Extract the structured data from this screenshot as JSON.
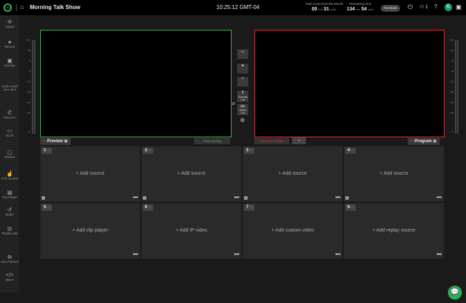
{
  "header": {
    "logo": "TVU",
    "title": "Morning Talk Show",
    "clock": "10:25:12 GMT-04",
    "consumed": {
      "label": "Total Consumed this Month",
      "hrs": "00",
      "mins": "31",
      "hrs_unit": "hrs",
      "mins_unit": "mins"
    },
    "remaining": {
      "label": "Remaining time",
      "hrs": "134",
      "mins": "54",
      "hrs_unit": "hrs",
      "mins_unit": "mins"
    },
    "purchase": "Purchase",
    "users_count": "1",
    "avatar": "C"
  },
  "sidebar": [
    {
      "label": "Output",
      "icon": "✢"
    },
    {
      "label": "Record",
      "icon": "●"
    },
    {
      "label": "Overlay",
      "icon": "▣"
    },
    {
      "label": "Audio mixer AFV OFF",
      "icon": "⫶"
    },
    {
      "label": "Intercom",
      "icon": "✆"
    },
    {
      "label": "SCTE",
      "icon": "▭"
    },
    {
      "label": "Monitor",
      "icon": "▢"
    },
    {
      "label": "PTZ Control",
      "icon": "☝"
    },
    {
      "label": "Clip Player",
      "icon": "▤"
    },
    {
      "label": "Buffer",
      "icon": "↺"
    },
    {
      "label": "Replay App",
      "icon": "◎"
    },
    {
      "label": "Auto Failover",
      "icon": "⧉"
    },
    {
      "label": "Macro",
      "icon": "</>"
    }
  ],
  "meter_scale": [
    "+12",
    "+6",
    "0",
    "-6",
    "-12",
    "-18",
    "-24",
    "-30",
    "-∞"
  ],
  "preview": {
    "label": "Preview",
    "clear_overlay": "Clear overlay",
    "color": "#4caf50"
  },
  "program": {
    "label": "Program",
    "remove_overlay": "Remove overlay",
    "color": "#e0303e"
  },
  "transitions": [
    {
      "label": ""
    },
    {
      "label": ""
    },
    {
      "label": ""
    },
    {
      "label": "Overlay Cut"
    },
    {
      "label": "Video Cut"
    }
  ],
  "tiles": [
    {
      "num": "1",
      "text": "+ Add source"
    },
    {
      "num": "2",
      "text": "+ Add source"
    },
    {
      "num": "3",
      "text": "+ Add source"
    },
    {
      "num": "4",
      "text": "+ Add source"
    },
    {
      "num": "5",
      "text": "+ Add clip player"
    },
    {
      "num": "6",
      "text": "+ Add IP video"
    },
    {
      "num": "7",
      "text": "+ Add custom video"
    },
    {
      "num": "8",
      "text": "+ Add replay source"
    }
  ],
  "tile_menu": "•••"
}
